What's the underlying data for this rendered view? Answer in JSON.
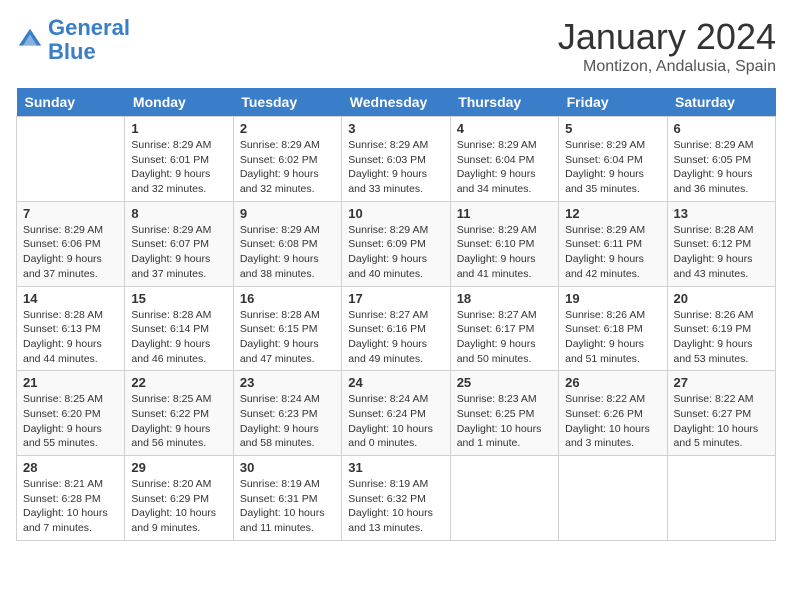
{
  "header": {
    "logo_line1": "General",
    "logo_line2": "Blue",
    "month_title": "January 2024",
    "location": "Montizon, Andalusia, Spain"
  },
  "days_of_week": [
    "Sunday",
    "Monday",
    "Tuesday",
    "Wednesday",
    "Thursday",
    "Friday",
    "Saturday"
  ],
  "weeks": [
    [
      {
        "day": "",
        "sunrise": "",
        "sunset": "",
        "daylight": ""
      },
      {
        "day": "1",
        "sunrise": "Sunrise: 8:29 AM",
        "sunset": "Sunset: 6:01 PM",
        "daylight": "Daylight: 9 hours and 32 minutes."
      },
      {
        "day": "2",
        "sunrise": "Sunrise: 8:29 AM",
        "sunset": "Sunset: 6:02 PM",
        "daylight": "Daylight: 9 hours and 32 minutes."
      },
      {
        "day": "3",
        "sunrise": "Sunrise: 8:29 AM",
        "sunset": "Sunset: 6:03 PM",
        "daylight": "Daylight: 9 hours and 33 minutes."
      },
      {
        "day": "4",
        "sunrise": "Sunrise: 8:29 AM",
        "sunset": "Sunset: 6:04 PM",
        "daylight": "Daylight: 9 hours and 34 minutes."
      },
      {
        "day": "5",
        "sunrise": "Sunrise: 8:29 AM",
        "sunset": "Sunset: 6:04 PM",
        "daylight": "Daylight: 9 hours and 35 minutes."
      },
      {
        "day": "6",
        "sunrise": "Sunrise: 8:29 AM",
        "sunset": "Sunset: 6:05 PM",
        "daylight": "Daylight: 9 hours and 36 minutes."
      }
    ],
    [
      {
        "day": "7",
        "sunrise": "Sunrise: 8:29 AM",
        "sunset": "Sunset: 6:06 PM",
        "daylight": "Daylight: 9 hours and 37 minutes."
      },
      {
        "day": "8",
        "sunrise": "Sunrise: 8:29 AM",
        "sunset": "Sunset: 6:07 PM",
        "daylight": "Daylight: 9 hours and 37 minutes."
      },
      {
        "day": "9",
        "sunrise": "Sunrise: 8:29 AM",
        "sunset": "Sunset: 6:08 PM",
        "daylight": "Daylight: 9 hours and 38 minutes."
      },
      {
        "day": "10",
        "sunrise": "Sunrise: 8:29 AM",
        "sunset": "Sunset: 6:09 PM",
        "daylight": "Daylight: 9 hours and 40 minutes."
      },
      {
        "day": "11",
        "sunrise": "Sunrise: 8:29 AM",
        "sunset": "Sunset: 6:10 PM",
        "daylight": "Daylight: 9 hours and 41 minutes."
      },
      {
        "day": "12",
        "sunrise": "Sunrise: 8:29 AM",
        "sunset": "Sunset: 6:11 PM",
        "daylight": "Daylight: 9 hours and 42 minutes."
      },
      {
        "day": "13",
        "sunrise": "Sunrise: 8:28 AM",
        "sunset": "Sunset: 6:12 PM",
        "daylight": "Daylight: 9 hours and 43 minutes."
      }
    ],
    [
      {
        "day": "14",
        "sunrise": "Sunrise: 8:28 AM",
        "sunset": "Sunset: 6:13 PM",
        "daylight": "Daylight: 9 hours and 44 minutes."
      },
      {
        "day": "15",
        "sunrise": "Sunrise: 8:28 AM",
        "sunset": "Sunset: 6:14 PM",
        "daylight": "Daylight: 9 hours and 46 minutes."
      },
      {
        "day": "16",
        "sunrise": "Sunrise: 8:28 AM",
        "sunset": "Sunset: 6:15 PM",
        "daylight": "Daylight: 9 hours and 47 minutes."
      },
      {
        "day": "17",
        "sunrise": "Sunrise: 8:27 AM",
        "sunset": "Sunset: 6:16 PM",
        "daylight": "Daylight: 9 hours and 49 minutes."
      },
      {
        "day": "18",
        "sunrise": "Sunrise: 8:27 AM",
        "sunset": "Sunset: 6:17 PM",
        "daylight": "Daylight: 9 hours and 50 minutes."
      },
      {
        "day": "19",
        "sunrise": "Sunrise: 8:26 AM",
        "sunset": "Sunset: 6:18 PM",
        "daylight": "Daylight: 9 hours and 51 minutes."
      },
      {
        "day": "20",
        "sunrise": "Sunrise: 8:26 AM",
        "sunset": "Sunset: 6:19 PM",
        "daylight": "Daylight: 9 hours and 53 minutes."
      }
    ],
    [
      {
        "day": "21",
        "sunrise": "Sunrise: 8:25 AM",
        "sunset": "Sunset: 6:20 PM",
        "daylight": "Daylight: 9 hours and 55 minutes."
      },
      {
        "day": "22",
        "sunrise": "Sunrise: 8:25 AM",
        "sunset": "Sunset: 6:22 PM",
        "daylight": "Daylight: 9 hours and 56 minutes."
      },
      {
        "day": "23",
        "sunrise": "Sunrise: 8:24 AM",
        "sunset": "Sunset: 6:23 PM",
        "daylight": "Daylight: 9 hours and 58 minutes."
      },
      {
        "day": "24",
        "sunrise": "Sunrise: 8:24 AM",
        "sunset": "Sunset: 6:24 PM",
        "daylight": "Daylight: 10 hours and 0 minutes."
      },
      {
        "day": "25",
        "sunrise": "Sunrise: 8:23 AM",
        "sunset": "Sunset: 6:25 PM",
        "daylight": "Daylight: 10 hours and 1 minute."
      },
      {
        "day": "26",
        "sunrise": "Sunrise: 8:22 AM",
        "sunset": "Sunset: 6:26 PM",
        "daylight": "Daylight: 10 hours and 3 minutes."
      },
      {
        "day": "27",
        "sunrise": "Sunrise: 8:22 AM",
        "sunset": "Sunset: 6:27 PM",
        "daylight": "Daylight: 10 hours and 5 minutes."
      }
    ],
    [
      {
        "day": "28",
        "sunrise": "Sunrise: 8:21 AM",
        "sunset": "Sunset: 6:28 PM",
        "daylight": "Daylight: 10 hours and 7 minutes."
      },
      {
        "day": "29",
        "sunrise": "Sunrise: 8:20 AM",
        "sunset": "Sunset: 6:29 PM",
        "daylight": "Daylight: 10 hours and 9 minutes."
      },
      {
        "day": "30",
        "sunrise": "Sunrise: 8:19 AM",
        "sunset": "Sunset: 6:31 PM",
        "daylight": "Daylight: 10 hours and 11 minutes."
      },
      {
        "day": "31",
        "sunrise": "Sunrise: 8:19 AM",
        "sunset": "Sunset: 6:32 PM",
        "daylight": "Daylight: 10 hours and 13 minutes."
      },
      {
        "day": "",
        "sunrise": "",
        "sunset": "",
        "daylight": ""
      },
      {
        "day": "",
        "sunrise": "",
        "sunset": "",
        "daylight": ""
      },
      {
        "day": "",
        "sunrise": "",
        "sunset": "",
        "daylight": ""
      }
    ]
  ]
}
